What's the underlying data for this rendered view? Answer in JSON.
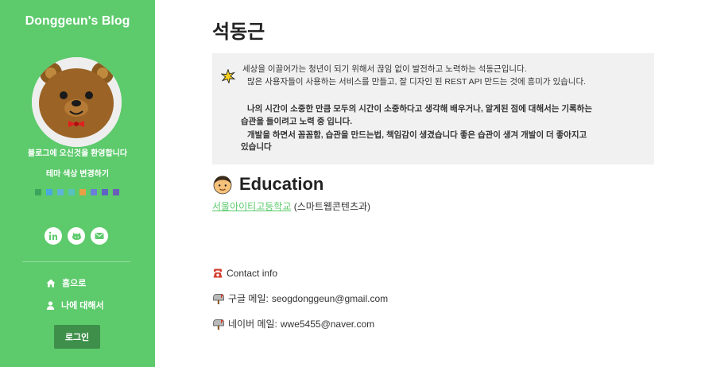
{
  "sidebar": {
    "blog_title": "Donggeun's Blog",
    "welcome_text": "블로그에 오신것을 환영합니다",
    "theme_change": "테마 색상 변경하기",
    "swatch_colors": [
      "#3aa55a",
      "#49a9e0",
      "#5fb3d9",
      "#58c2c0",
      "#e8a045",
      "#6b7fd6",
      "#5e63c4",
      "#6a5cb8"
    ],
    "social_icons": [
      "linkedin-icon",
      "github-icon",
      "mail-icon"
    ],
    "nav": [
      {
        "label": "홈으로",
        "icon": "home-icon"
      },
      {
        "label": "나에 대해서",
        "icon": "user-icon"
      }
    ],
    "login_label": "로그인",
    "accent_color": "#5dca6c"
  },
  "main": {
    "title": "석동근",
    "intro": {
      "icon": "sparkle-icon",
      "lines": [
        "세상을 이끌어가는 청년이 되기 위해서 끊임 없이 발전하고 노력하는 석동근입니다.",
        "많은 사용자들이 사용하는 서비스를 만들고, 잘 디자인 된 REST API 만드는 것에 흥미가 있습니다.",
        "나의 시간이 소중한 만큼 모두의 시간이 소중하다고 생각해 배우거나, 알게된 점에 대해서는 기록하는",
        "습관을 들이려고 노력 중 입니다.",
        "개발을 하면서 꼼꼼함, 습관을 만드는법, 책임감이 생겼습니다 좋은 습관이 생겨 개발이 더 좋아지고",
        "있습니다"
      ]
    },
    "education": {
      "heading": "Education",
      "icon": "student-face-icon",
      "school": "서울아이티고등학교",
      "department": "(스마트웹콘텐츠과)"
    },
    "contact": {
      "heading": "Contact info",
      "google_label": "구글 메일:",
      "google_email": "seogdonggeun@gmail.com",
      "naver_label": "네이버 메일:",
      "naver_email": "wwe5455@naver.com"
    }
  }
}
